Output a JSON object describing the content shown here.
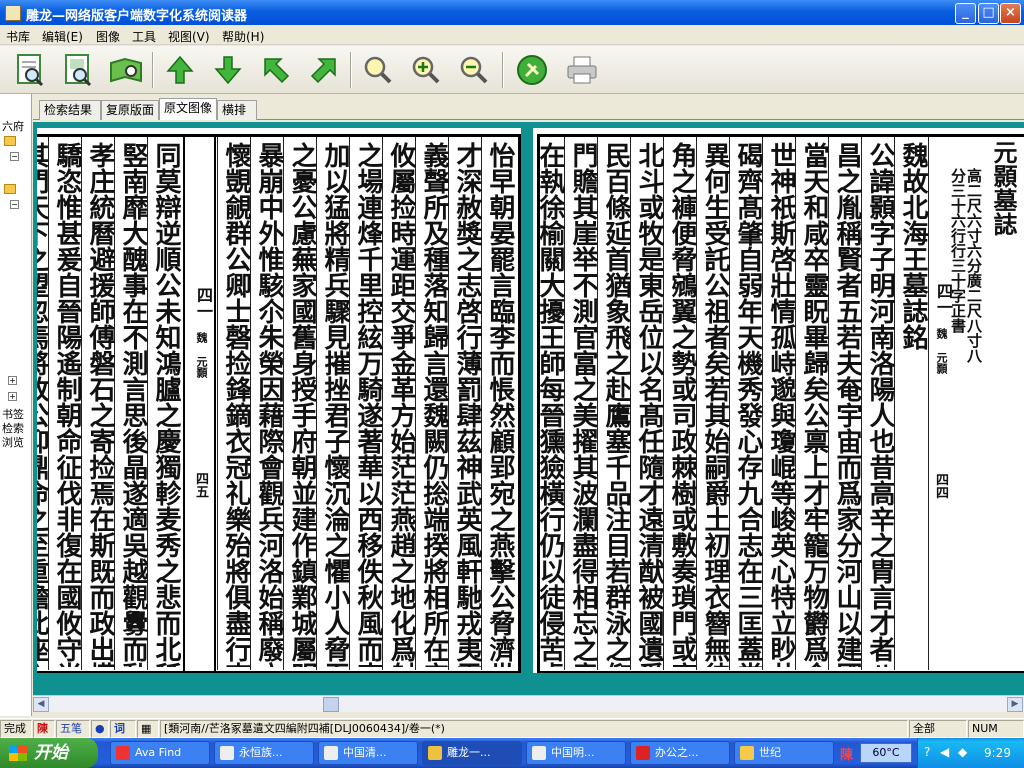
{
  "window": {
    "title": "雕龙—网络版客户端数字化系统阅读器",
    "controls": {
      "minimize": "_",
      "maximize": "□",
      "close": "×"
    }
  },
  "menu": [
    "书库",
    "编辑(E)",
    "图像",
    "工具",
    "视图(V)",
    "帮助(H)"
  ],
  "toolbar": {
    "buttons": [
      "book-search-icon",
      "page-search-icon",
      "open-book-icon",
      "arrow-up-icon",
      "arrow-down-icon",
      "arrow-upleft-icon",
      "arrow-upright-icon",
      "magnifier-icon",
      "zoom-in-icon",
      "zoom-out-icon",
      "tools-icon",
      "print-icon"
    ]
  },
  "left_pane": {
    "items": [
      "六府",
      "书签",
      "检索",
      "浏览"
    ]
  },
  "tabs": [
    "检索结果",
    "复原版面",
    "原文图像",
    "横排"
  ],
  "active_tab": 2,
  "page_right": {
    "title_col": "元顥墓誌",
    "sub_col1": "高二尺六寸六分廣二尺八寸八",
    "sub_col2": "分三十六行行三十字正書",
    "heading_col": "魏故北海王墓誌銘",
    "columns": [
      "公諱顥字子明河南洛陽人也昔高辛之胄言才者八姬",
      "昌之胤稱賢者五若夫奄宇宙而爲家分河山以建國固",
      "當天和咸卒靈眖畢歸矣公禀上才牢籠万物欝爲命",
      "世神祇斯啓壯情孤峙邈與瓊崐等峻英心特立眇共瑤",
      "碣齊髙肇自弱年天機秀發心存九合志在三匡蓋當見",
      "異何生受託公祖者矣若其始嗣爵土初理衣簪無待年",
      "角之褲便脅鵷翼之勢或司政棘樹或敷奏瑣門或官如",
      "北斗或牧是東岳位以名髙任隨才遠清猷被國遺愛在",
      "民百條延首猶象飛之赴鷹塞千品注目若群泳之仰龍",
      "門贍其崖举不測官富之美擢其波瀾盡得相忘之意歲",
      "在執徐榆關大擾王師每晉獯獫橫行仍以徒侵苦虐吏",
      "之浸流式積懷歸之思緑邊万里鼠啓群飛天子乃睠不"
    ],
    "margin_label": "四一",
    "margin_sub": "魏 元顥",
    "page_number": "四四"
  },
  "page_left": {
    "columns": [
      "怡早朝晏罷言臨李而悵然顧郢宛之燕擊公脅濟世之",
      "才深赦獎之志啓行薄罰肆茲神武英風軒馳戎夷震懾",
      "義聲所及種落知歸言還魏闕仍捴端揆將相所在安危",
      "攸屬捡時運距交爭金革方始茫茫燕趙之地化爲射獵",
      "之場連烽千里控絃万騎遂著華以西移佚秋風而南首",
      "加以猛將精兵驟見摧挫君子懷沉淪之懼小人脅吞噬",
      "之憂公慮蕪家國舊身授手府朝並建作鎮鄴城屬明皇",
      "暴崩中外惟駭尒朱榮因藉際會觀兵河洛始稱廢立仍",
      "懷覬覦群公卿士磬捡鋒鏑衣冠礼樂殆將俱盡行李異",
      "同莫辯逆順公未知鴻臚之慶獨軫麦秀之悲而北秖强",
      "竪南靡大醜事在不測言思後晶遂適吳越觀釁而動",
      "孝庄統曆避援師傅磐石之寄捡焉在斯既而政出權胡",
      "驕恣惟甚爰自晉陽遙制朝命征伐非復在國攸守肖出",
      "其門天下之望忽焉將改公仰鼎命之至重瞻此座之可",
      "惜捴衆百越來赴三川而金滕未刊流言競起兵次牢洛"
    ],
    "margin_label": "四一",
    "margin_sub": "魏 元顥",
    "page_number": "四五"
  },
  "bottom_page_number": "1",
  "statusbar": {
    "status": "完成",
    "ime_label": "陳",
    "ime_mode": "五笔",
    "path": "[類河南//芒洛冢墓遺文四編附四補[DLJ0060434]/卷一(*)",
    "scope": "全部",
    "num": "NUM"
  },
  "taskbar": {
    "start": "开始",
    "tasks": [
      "Ava Find",
      "永恒族...",
      "中国清...",
      "雕龙一...",
      "中国明...",
      "办公之...",
      "世纪"
    ],
    "active_task": 3,
    "tray_temp": "60°C",
    "tray_ime": "陳",
    "clock": "9:29"
  },
  "colors": {
    "titlebar": "#0a5fe0",
    "content_bg": "#0f9192",
    "taskbar": "#245edb"
  }
}
